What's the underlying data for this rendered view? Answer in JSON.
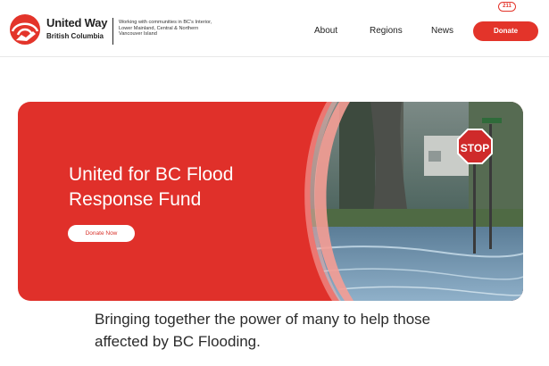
{
  "brand": {
    "name": "United Way",
    "region": "British Columbia",
    "tagline": "Working with communities in BC's Interior, Lower Mainland, Central & Northern Vancouver Island",
    "logo_icon": "united-way-hand-logo-icon"
  },
  "nav": {
    "items": [
      {
        "label": "About"
      },
      {
        "label": "Regions"
      },
      {
        "label": "News"
      }
    ],
    "donate_label": "Donate",
    "call_badge": "211"
  },
  "hero": {
    "title": "United for BC Flood Response Fund",
    "button_label": "Donate Now",
    "sign_text": "STOP",
    "bg_color": "#e0302a"
  },
  "lead": {
    "text": "Bringing together the power of many to help those affected by BC Flooding."
  },
  "colors": {
    "accent": "#e3342a",
    "text": "#2b2b2b"
  }
}
